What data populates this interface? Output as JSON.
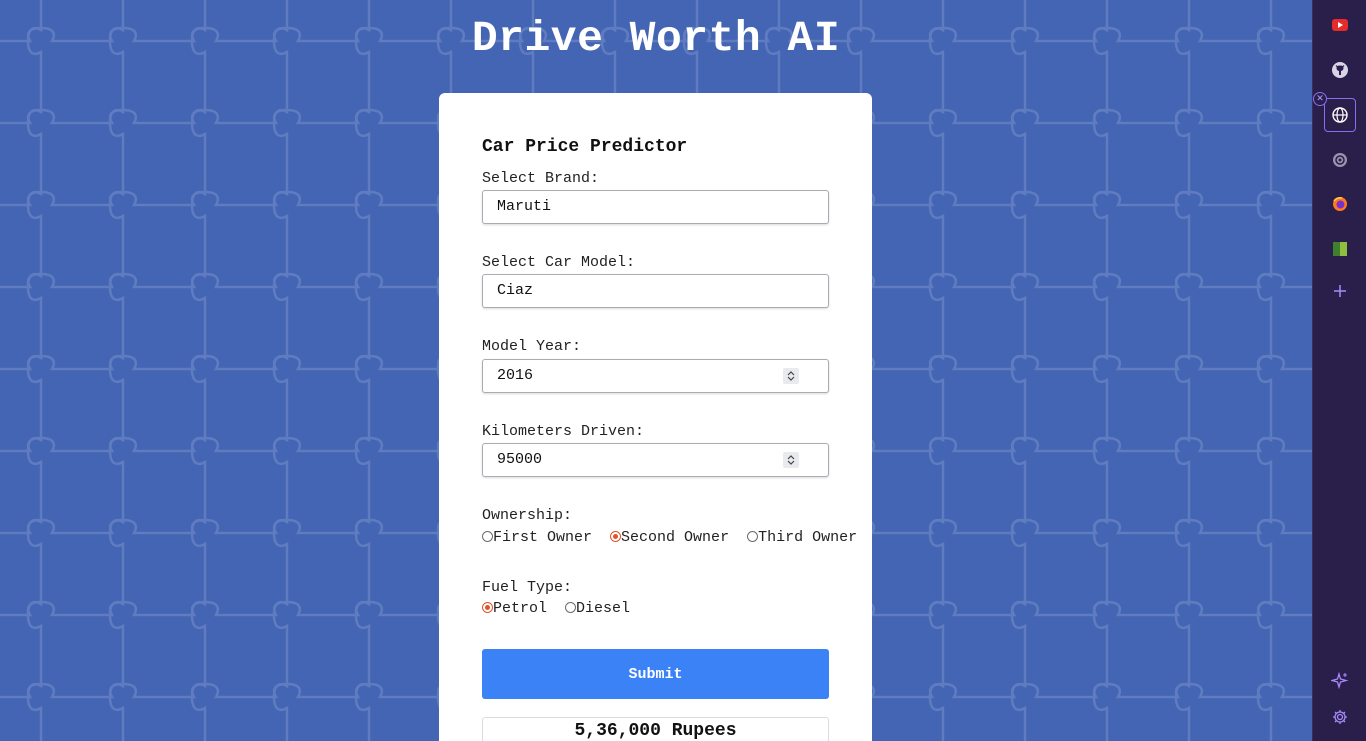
{
  "app": {
    "title": "Drive Worth AI"
  },
  "form": {
    "title": "Car Price Predictor",
    "brand": {
      "label": "Select Brand:",
      "value": "Maruti"
    },
    "model": {
      "label": "Select Car Model:",
      "value": "Ciaz"
    },
    "year": {
      "label": "Model Year:",
      "value": "2016"
    },
    "km": {
      "label": "Kilometers Driven:",
      "value": "95000"
    },
    "ownership": {
      "label": "Ownership:",
      "options": [
        "First Owner",
        "Second Owner",
        "Third Owner"
      ],
      "selected": "Second Owner"
    },
    "fuel": {
      "label": "Fuel Type:",
      "options": [
        "Petrol",
        "Diesel"
      ],
      "selected": "Petrol"
    },
    "submit_label": "Submit",
    "result": "5,36,000 Rupees"
  },
  "sidebar": {
    "items": [
      "youtube-icon",
      "github-icon",
      "globe-icon",
      "openai-icon",
      "firefox-icon",
      "notebook-icon",
      "plus-icon"
    ],
    "bottom": [
      "sparkle-icon",
      "gear-icon"
    ]
  },
  "colors": {
    "background": "#4365b3",
    "submit": "#3b82f6",
    "radio_checked": "#e0532b",
    "sidebar": "#2a1e4a"
  }
}
